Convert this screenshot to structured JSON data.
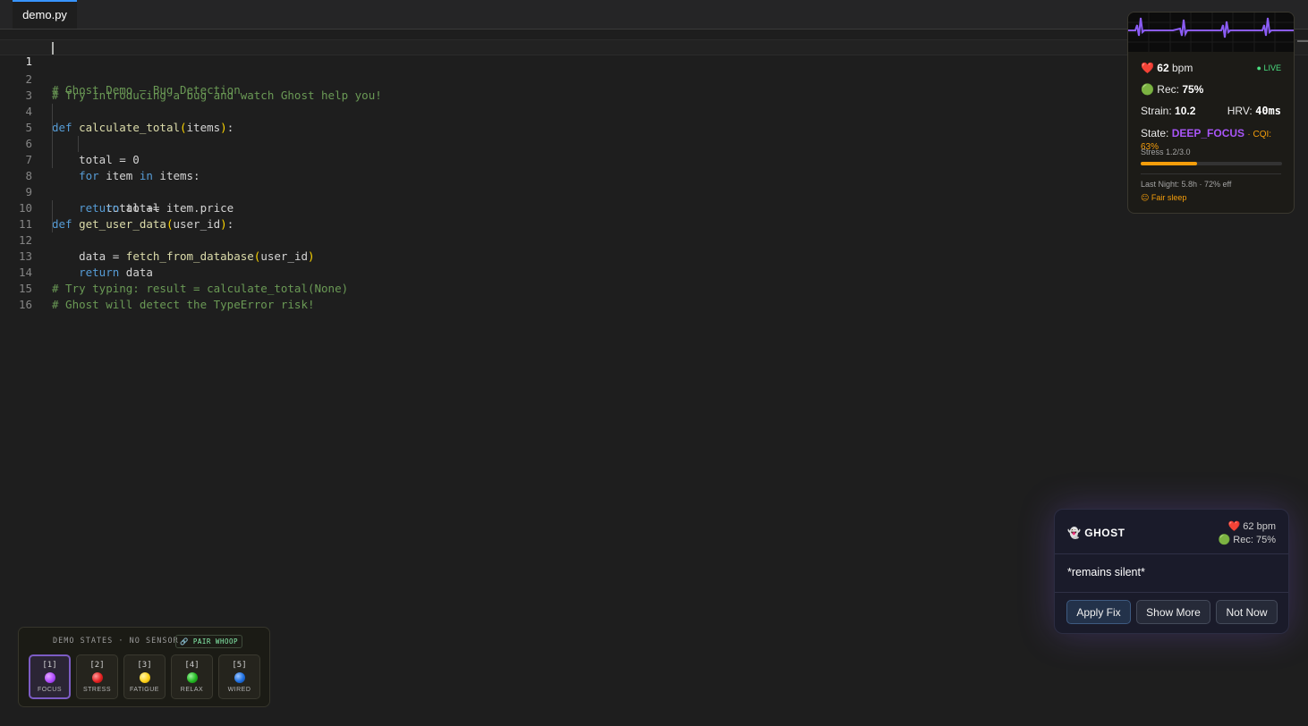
{
  "tab": {
    "label": "demo.py"
  },
  "code_lines": [
    "# Ghost Demo — Bug Detection",
    "# Try introducing a bug and watch Ghost help you!",
    "",
    "def calculate_total(items):",
    "    total = 0",
    "    for item in items:",
    "        total += item.price",
    "    return total",
    "",
    "def get_user_data(user_id):",
    "    data = fetch_from_database(user_id)",
    "    return data",
    "",
    "# Try typing: result = calculate_total(None)",
    "# Ghost will detect the TypeError risk!",
    ""
  ],
  "bio": {
    "heart_icon": "heart-icon",
    "bpm_value": "62",
    "bpm_unit": "bpm",
    "live": "● LIVE",
    "rec_label": "Rec:",
    "rec_value": "75%",
    "strain_label": "Strain:",
    "strain_value": "10.2",
    "hrv_label": "HRV:",
    "hrv_value": "40ms",
    "state_label": "State:",
    "state_value": "DEEP_FOCUS",
    "cqi": "· CQI: 63%",
    "stress_text": "Stress 1.2/3.0",
    "stress_fraction": 0.4,
    "last_night": "Last Night: 5.8h · 72% eff",
    "sleep_quality": "Fair sleep",
    "colors": {
      "wave": "#8b5cf6",
      "state": "#a855f7",
      "stress": "#f59e0b"
    }
  },
  "ghost": {
    "title": "GHOST",
    "bpm": "62 bpm",
    "rec": "Rec: 75%",
    "message": "*remains silent*",
    "buttons": {
      "apply": "Apply Fix",
      "more": "Show More",
      "not_now": "Not Now"
    }
  },
  "demo": {
    "header": "DEMO STATES · NO SENSOR",
    "pair_label": "PAIR WHOOP",
    "states": [
      {
        "key": "[1]",
        "label": "FOCUS",
        "color": "#b14dff",
        "active": true
      },
      {
        "key": "[2]",
        "label": "STRESS",
        "color": "#e52121",
        "active": false
      },
      {
        "key": "[3]",
        "label": "FATIGUE",
        "color": "#ffd21a",
        "active": false
      },
      {
        "key": "[4]",
        "label": "RELAX",
        "color": "#22b822",
        "active": false
      },
      {
        "key": "[5]",
        "label": "WIRED",
        "color": "#1e6fe0",
        "active": false
      }
    ]
  }
}
